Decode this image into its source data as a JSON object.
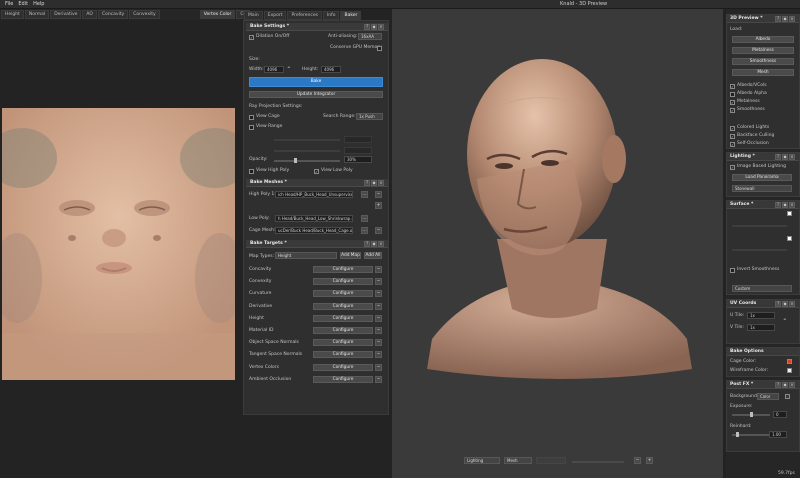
{
  "menu": [
    "File",
    "Edit",
    "Help"
  ],
  "texture_tabs": [
    "Height",
    "Normal",
    "Derivative",
    "AO",
    "Concavity",
    "Convexity",
    "Vertex Color",
    "Cu"
  ],
  "texture_active_tab": "Vertex Color",
  "bake_tabs": [
    "Main",
    "Export",
    "Preferences",
    "Info",
    "Baker"
  ],
  "bake_active_tab": "Baker",
  "window_title": "Knald - 3D Preview",
  "bake_settings": {
    "title": "Bake Settings *",
    "dilation": "Dilation On/Off",
    "anti_aliasing_label": "Anti-aliasing:",
    "anti_aliasing_value": "16xAA",
    "conserve_gpu": "Conserve GPU Memory",
    "size_label": "Size:",
    "width_label": "Width:",
    "width_value": "4096",
    "height_label": "Height:",
    "height_value": "4096",
    "bake_button": "Bake",
    "update_button": "Update Integrator",
    "ray_label": "Ray Projection Settings:",
    "view_cage": "View Cage",
    "search_range_label": "Search Range:",
    "search_range_value": "1x Push",
    "view_range": "View Range",
    "opacity_label": "Opacity:",
    "opacity_value": "30%",
    "opacity_level": 0.3,
    "view_high_poly": "View High Poly",
    "view_low_poly": "View Low Poly"
  },
  "bake_meshes": {
    "title": "Bake Meshes *",
    "high_poly_label": "High Poly 1:",
    "high_poly_value": "ich Head/HP_Buck_Head_Unsupervised.obj",
    "low_poly_label": "Low Poly:",
    "low_poly_value": "h Head/Buck_Head_Low_Shrinkwrap.obj",
    "cage_label": "Cage Mesh:",
    "cage_value": "ucDer/Buck Head/Buck_Head_Cage.obj"
  },
  "bake_targets": {
    "title": "Bake Targets *",
    "map_types_label": "Map Types:",
    "map_type_value": "Height",
    "add_map": "Add Map",
    "add_all": "Add All",
    "configure_label": "Configure",
    "targets": [
      "Concavity",
      "Convexity",
      "Curvature",
      "Derivative",
      "Height",
      "Material ID",
      "Object Space Normals",
      "Tangent Space Normals",
      "Vertex Colors",
      "Ambient Occlusion"
    ]
  },
  "preview": {
    "title": "3D Preview *",
    "load_label": "Load:",
    "load_buttons": [
      "Albedo",
      "Metalness",
      "Smoothness",
      "Mesh"
    ],
    "checks": [
      "Albedo/VCols",
      "Albedo Alpha",
      "Metalness",
      "Smoothness"
    ],
    "checks_state": [
      true,
      false,
      true,
      true
    ],
    "checks2": [
      "Colored Lights",
      "Backface Culling",
      "Self-Occlusion"
    ],
    "checks2_state": [
      true,
      true,
      true
    ]
  },
  "lighting": {
    "title": "Lighting *",
    "ibl": "Image Based Lighting",
    "load_panorama": "Load Panorama",
    "preset": "Stonewall"
  },
  "surface": {
    "title": "Surface *",
    "invert_smoothness": "Invert Smoothness",
    "preset": "Custom"
  },
  "uv": {
    "title": "UV Coords",
    "u_label": "U Tile:",
    "u_value": "1x",
    "v_label": "V Tile:",
    "v_value": "1x"
  },
  "bake_options": {
    "title": "Bake Options",
    "cage_color": "Cage Color:",
    "cage_hex": "#e0401c",
    "wire_color": "Wireframe Color:",
    "wire_hex": "#f0f0f0"
  },
  "post_fx": {
    "title": "Post FX *",
    "background_label": "Background:",
    "background_value": "Color",
    "exposure_label": "Exposure:",
    "exposure_value": "0",
    "exposure_level": 0.5,
    "rainhard_label": "Reinhard:",
    "rainhard_value": "1.00",
    "rainhard_level": 0.1
  },
  "viewport_bar": {
    "mode": "Lighting",
    "display": "Mesh"
  },
  "fps": "59.7fps",
  "icons": {
    "help": "help-icon",
    "pin": "pin-icon",
    "close": "close-icon",
    "browse": "browse-icon",
    "add": "add-icon",
    "remove": "remove-icon"
  }
}
